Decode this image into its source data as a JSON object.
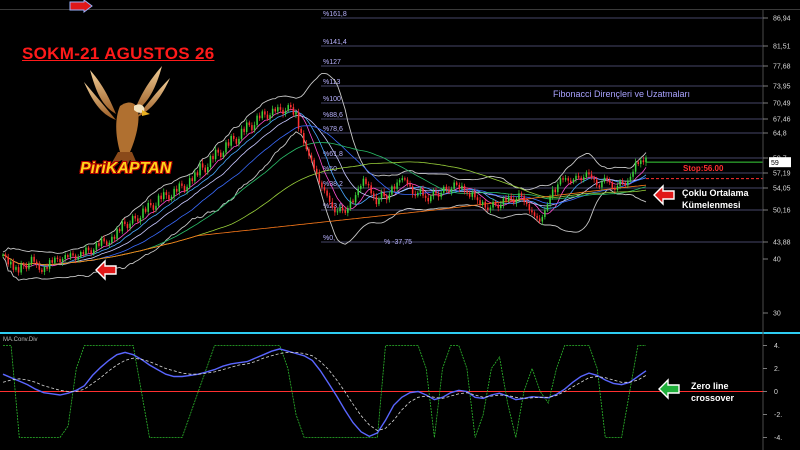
{
  "title": "SOKM-21 AGUSTOS 26",
  "brand": "PiriKAPTAN",
  "fibo_title": "Fibonacci Dirençleri ve Uzatmaları",
  "stop_label": "Stop:56.00",
  "annotation_ma": [
    "Çoklu Ortalama",
    "Kümelenmesi"
  ],
  "annotation_macd": [
    "Zero line",
    "crossover"
  ],
  "macd_title": "MA.Conv.Div",
  "colors": {
    "up": "#3ad23a",
    "down": "#ff3030",
    "bb": "#c8c8c8",
    "fib": "#5e5e8a",
    "accent": "#ff1a1a",
    "macd": "#5a66ff",
    "signal": "#d8d8d8",
    "histo": "#2dbb2d"
  },
  "icons": [
    "left-arrow-icon",
    "right-arrow-icon",
    "eagle-logo-icon"
  ],
  "chart_data": [
    {
      "type": "candlestick",
      "title": "SOKM-21 AGUSTOS 26",
      "ylim": [
        26,
        88
      ],
      "y_ticks": [
        86.94,
        81.51,
        77.68,
        73.95,
        70.49,
        67.46,
        64.8,
        59.7,
        57.19,
        54.05,
        50.16,
        43.88,
        40,
        30
      ],
      "fibonacci_levels": [
        {
          "label": "%161,8",
          "value": 86.94
        },
        {
          "label": "%141,4",
          "value": 81.51
        },
        {
          "label": "%127",
          "value": 77.68
        },
        {
          "label": "%113",
          "value": 73.95
        },
        {
          "label": "%100",
          "value": 70.49
        },
        {
          "label": "%88,6",
          "value": 67.46
        },
        {
          "label": "%78,6",
          "value": 64.8
        },
        {
          "label": "%61,8",
          "value": 59.7
        },
        {
          "label": "%50",
          "value": 57.19
        },
        {
          "label": "%38,2",
          "value": 54.05
        },
        {
          "label": "%23,6",
          "value": 50.16
        },
        {
          "label": "%0,",
          "value": 43.88
        }
      ],
      "low_label": "% -37,75",
      "last_price": 59.0,
      "stop": 56.0,
      "close": [
        41,
        40.5,
        39,
        39.5,
        38,
        38.5,
        37.5,
        39,
        38.8,
        38.2,
        39.2,
        40.5,
        39.5,
        39,
        38,
        37.6,
        38.5,
        38.2,
        39.8,
        39.3,
        40.3,
        40,
        39.4,
        40,
        40.9,
        40.4,
        41.3,
        40.8,
        39.9,
        40.5,
        41.6,
        41.1,
        42.6,
        42,
        41.1,
        42.1,
        43.6,
        43,
        44.6,
        44,
        43.2,
        43.7,
        44.9,
        44.5,
        46.4,
        46,
        47.9,
        47.4,
        46.6,
        47.5,
        49,
        48.5,
        47.9,
        48.6,
        50.4,
        49.8,
        51.4,
        51,
        50.2,
        50.9,
        52.7,
        52.1,
        53.3,
        52.8,
        52,
        52.5,
        53.9,
        53.4,
        55,
        54.5,
        53.5,
        54.3,
        56.1,
        55.5,
        57.3,
        56.7,
        58.8,
        58.1,
        57.3,
        58.2,
        60.1,
        59.5,
        61.4,
        60.8,
        59.9,
        60.8,
        62.9,
        62.2,
        64.2,
        63.6,
        62.6,
        63.6,
        65.6,
        65,
        66.8,
        66.3,
        65.3,
        66.3,
        68.1,
        67.6,
        68.9,
        68.3,
        67.5,
        68.2,
        69.4,
        68.9,
        69.7,
        69.2,
        68.4,
        69,
        70.1,
        69.7,
        68.3,
        68.8,
        65.6,
        64.8,
        62.7,
        61.5,
        60.2,
        59.4,
        57.9,
        57.1,
        55.2,
        54.2,
        53.6,
        52.7,
        51.6,
        50.7,
        49.7,
        49.9,
        50.6,
        50.1,
        49.6,
        50.5,
        51.8,
        51.5,
        52.8,
        53.9,
        54.5,
        56,
        54.9,
        54.6,
        53.1,
        52.5,
        51.2,
        52.2,
        53.3,
        52.6,
        52,
        52.9,
        54.4,
        53.9,
        55.2,
        55.7,
        56.1,
        55.8,
        54.9,
        54.4,
        53,
        52.7,
        53.2,
        53.9,
        52.7,
        52.3,
        51.7,
        52.6,
        53.5,
        53.1,
        52.5,
        53.2,
        54.3,
        53.8,
        53.4,
        53.9,
        55.2,
        54.7,
        53.9,
        54.5,
        53.6,
        53.2,
        52.5,
        53.3,
        52.4,
        51.9,
        51.1,
        51.6,
        50.6,
        50.2,
        50.6,
        51.6,
        51.1,
        50.5,
        51.1,
        52.2,
        51.8,
        52.6,
        52.1,
        51.4,
        52.1,
        53.1,
        52.6,
        51.6,
        51.2,
        50.1,
        49.7,
        49,
        48.5,
        47.9,
        48.8,
        50.1,
        51.2,
        52.4,
        53.8,
        53.3,
        54.8,
        56.1,
        55.8,
        56.1,
        55.6,
        55.2,
        55.8,
        56.6,
        56.2,
        55.7,
        56.3,
        57.3,
        56.9,
        56.2,
        55.8,
        54.6,
        54.2,
        55.4,
        56.2,
        55.7,
        55.2,
        54.1,
        53.7,
        54.5,
        55.5,
        55.1,
        54.6,
        55.6,
        56.4,
        57.4,
        59,
        58.7,
        59.3,
        59,
        59.8
      ],
      "series": [
        {
          "name": "MA.Conv.Div",
          "values": [
            1.5,
            1.2,
            0.9,
            0.6,
            0.2,
            -0.1,
            -0.2,
            -0.3,
            -0.15,
            0.1,
            0.5,
            1.4,
            2.1,
            2.7,
            3.2,
            3.4,
            3.2,
            2.8,
            2.3,
            1.9,
            1.5,
            1.3,
            1.3,
            1.4,
            1.5,
            1.7,
            1.9,
            2.2,
            2.4,
            2.5,
            2.6,
            2.9,
            3.2,
            3.5,
            3.7,
            3.5,
            3.3,
            3.1,
            2.7,
            1.8,
            0.7,
            -0.4,
            -1.6,
            -2.7,
            -3.5,
            -3.9,
            -3.6,
            -2.5,
            -1.2,
            -0.5,
            -0.1,
            0,
            -0.3,
            -0.7,
            -0.5,
            -0.1,
            0.1,
            0,
            -0.5,
            -0.6,
            -0.3,
            -0.15,
            -0.4,
            -0.7,
            -0.6,
            -0.45,
            -0.5,
            -0.55,
            -0.25,
            0.2,
            0.8,
            1.3,
            1.6,
            1.4,
            1.0,
            0.7,
            0.6,
            0.8,
            1.3,
            1.8
          ]
        },
        {
          "name": "",
          "values": [
            0.8,
            1.0,
            1.1,
            1.0,
            0.8,
            0.5,
            0.3,
            0.1,
            0.0,
            0.0,
            0.2,
            0.7,
            1.2,
            1.8,
            2.3,
            2.7,
            2.9,
            2.8,
            2.6,
            2.3,
            2.0,
            1.8,
            1.6,
            1.5,
            1.5,
            1.6,
            1.7,
            1.9,
            2.1,
            2.3,
            2.4,
            2.6,
            2.9,
            3.1,
            3.3,
            3.4,
            3.4,
            3.3,
            3.1,
            2.6,
            1.9,
            1.0,
            0.0,
            -1.1,
            -2.1,
            -2.9,
            -3.4,
            -3.2,
            -2.5,
            -1.6,
            -0.9,
            -0.5,
            -0.4,
            -0.5,
            -0.6,
            -0.4,
            -0.2,
            -0.1,
            -0.3,
            -0.5,
            -0.4,
            -0.3,
            -0.35,
            -0.5,
            -0.6,
            -0.55,
            -0.5,
            -0.5,
            -0.35,
            0.0,
            0.4,
            0.8,
            1.2,
            1.3,
            1.2,
            1.0,
            0.8,
            0.8,
            1.0,
            1.4
          ]
        }
      ],
      "macd_ylim": [
        -4.3,
        4.3
      ],
      "macd_y_ticks": [
        4,
        2,
        0,
        -2,
        -4
      ]
    }
  ]
}
